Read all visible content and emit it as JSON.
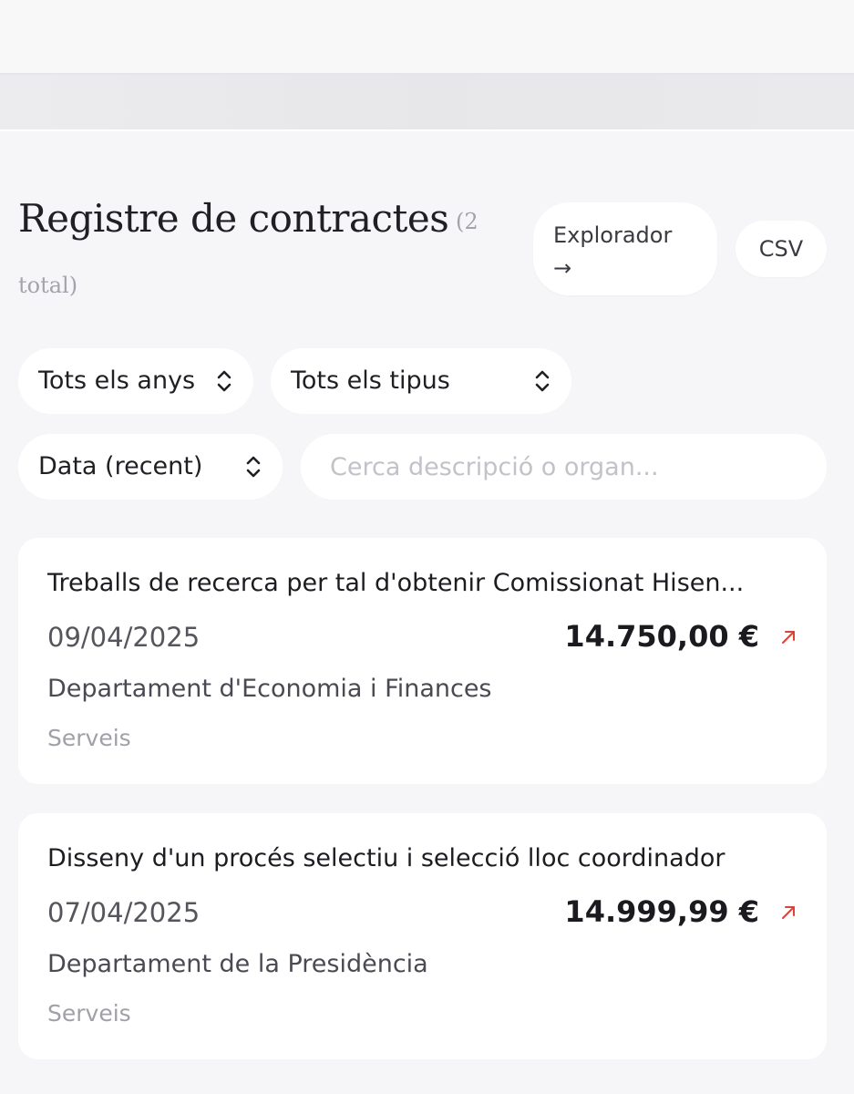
{
  "header": {
    "title": "Registre de contractes",
    "count_line1": "(2",
    "count_line2": "total)"
  },
  "actions": {
    "explorer_label": "Explorador\n→",
    "csv_label": "CSV"
  },
  "filters": {
    "year": "Tots els anys",
    "type": "Tots els tipus",
    "sort": "Data (recent)",
    "search_value": "",
    "search_placeholder": "Cerca descripció o organ..."
  },
  "contracts": [
    {
      "title": "Treballs de recerca per tal d'obtenir Comissionat Hisen...",
      "date": "09/04/2025",
      "amount": "14.750,00 €",
      "department": "Departament d'Economia i Finances",
      "type": "Serveis"
    },
    {
      "title": "Disseny d'un procés selectiu i selecció lloc coordinador",
      "date": "07/04/2025",
      "amount": "14.999,99 €",
      "department": "Departament de la Presidència",
      "type": "Serveis"
    }
  ],
  "icons": {
    "select_chevron": "chevron-up-down-icon",
    "external_link": "arrow-up-right-icon"
  },
  "colors": {
    "background": "#f6f6f9",
    "card": "#ffffff",
    "accent_arrow": "#d9443a",
    "muted_text": "#a0a0a8"
  }
}
